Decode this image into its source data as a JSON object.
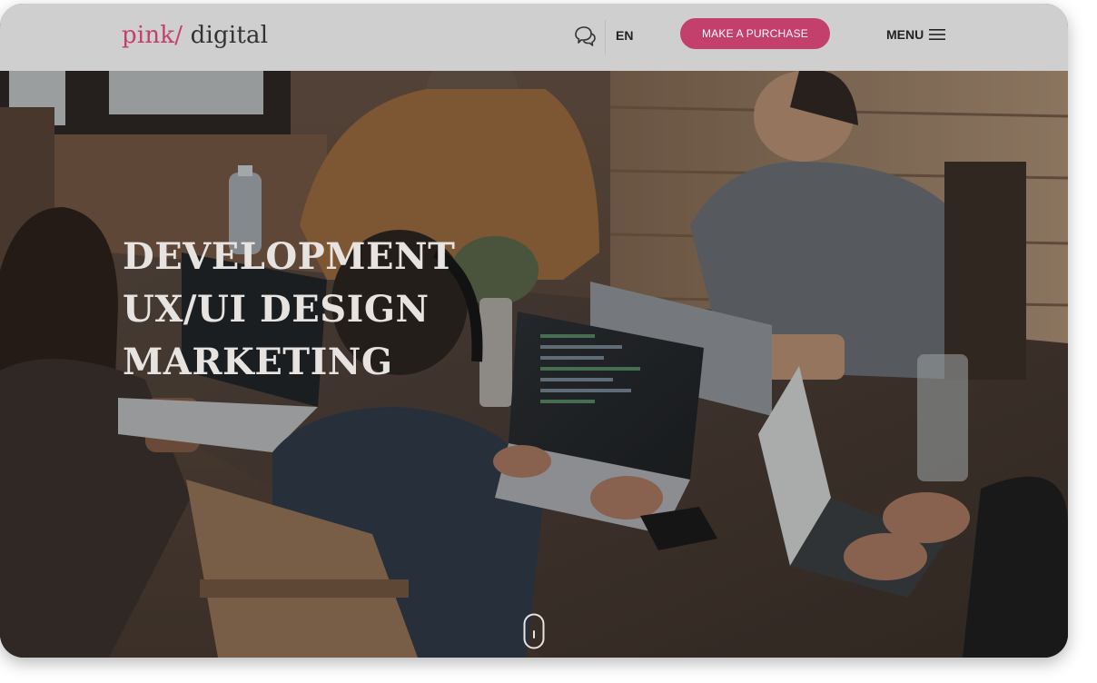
{
  "header": {
    "logo_brand": "pink/",
    "logo_rest": " digital",
    "language": "EN",
    "purchase_label": "MAKE A PURCHASE",
    "menu_label": "MENU",
    "icons": [
      "chat-icon",
      "hamburger-icon"
    ]
  },
  "hero": {
    "lines": [
      "DEVELOPMENT",
      "UX/UI DESIGN",
      "MARKETING"
    ],
    "scroll_icon": "mouse-scroll-icon"
  },
  "colors": {
    "brand_pink": "#c2406b",
    "header_bg": "#cfcfcf",
    "headline_text": "#e6e3e0"
  }
}
